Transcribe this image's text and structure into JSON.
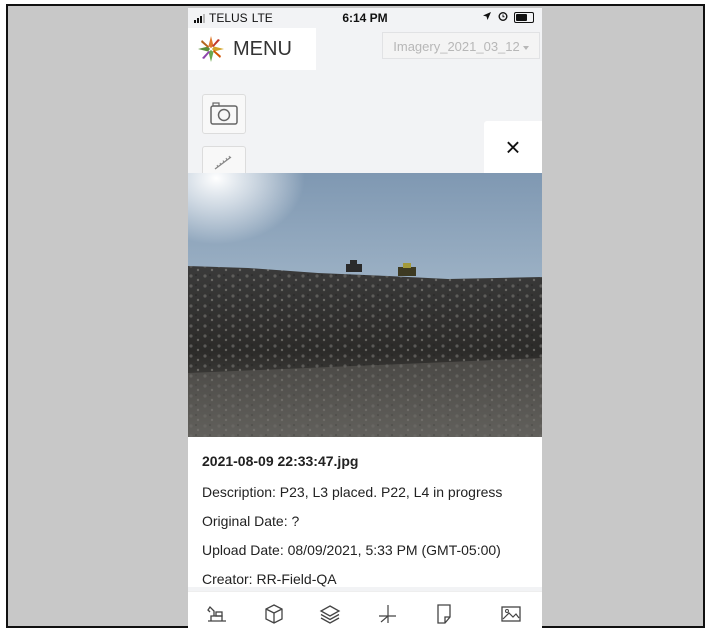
{
  "status_bar": {
    "carrier": "TELUS",
    "network": "LTE",
    "time": "6:14 PM"
  },
  "header": {
    "menu_label": "MENU",
    "imagery_selected": "Imagery_2021_03_12"
  },
  "photo_info": {
    "filename": "2021-08-09 22:33:47.jpg",
    "description": "Description: P23, L3 placed. P22, L4 in progress",
    "original_date": "Original Date: ?",
    "upload_date": "Upload Date: 08/09/2021, 5:33 PM (GMT-05:00)",
    "creator": "Creator: RR-Field-QA"
  },
  "close_glyph": "×",
  "icons": {
    "camera": "camera-icon",
    "ruler": "ruler-icon",
    "excavator": "excavator-icon",
    "cube": "cube-icon",
    "layers": "layers-icon",
    "axes": "axes-icon",
    "note": "note-icon",
    "image": "image-icon"
  }
}
